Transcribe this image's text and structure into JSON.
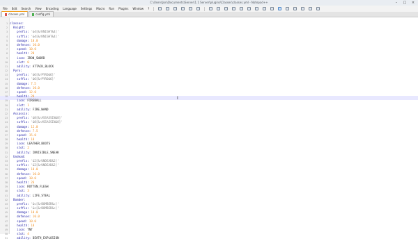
{
  "window": {
    "title": "C:\\Users\\Jon\\Documents\\Server\\1.1 Server\\plugins\\Classes\\classes.yml - Notepad++",
    "controls": [
      "–",
      "□",
      "×"
    ]
  },
  "menu": [
    "File",
    "Edit",
    "Search",
    "View",
    "Encoding",
    "Language",
    "Settings",
    "Macro",
    "Run",
    "Plugins",
    "Window",
    "?"
  ],
  "tabs": [
    {
      "label": "classes.yml",
      "active": true
    },
    {
      "label": "config.yml",
      "active": false
    }
  ],
  "colors": {
    "key": "#1a1aa6",
    "number": "#ef8c1c",
    "string": "#808080",
    "current_line": "#e8e8ff"
  },
  "lines": [
    {
      "n": "1",
      "indent": "",
      "key": "classes:",
      "val": "",
      "type": "t"
    },
    {
      "n": "2",
      "indent": "  ",
      "key": "Knight:",
      "val": "",
      "type": "t"
    },
    {
      "n": "3",
      "indent": "    ",
      "key": "prefix: ",
      "val": "'&4[&rKNIGHT&4]'",
      "type": "s"
    },
    {
      "n": "4",
      "indent": "    ",
      "key": "suffix: ",
      "val": "'&4[&rKNIGHT&4]'",
      "type": "s"
    },
    {
      "n": "5",
      "indent": "    ",
      "key": "damage: ",
      "val": "10.0",
      "type": "v"
    },
    {
      "n": "6",
      "indent": "    ",
      "key": "defense: ",
      "val": "10.0",
      "type": "v"
    },
    {
      "n": "7",
      "indent": "    ",
      "key": "speed: ",
      "val": "10.0",
      "type": "v"
    },
    {
      "n": "8",
      "indent": "    ",
      "key": "health: ",
      "val": "20",
      "type": "v"
    },
    {
      "n": "9",
      "indent": "    ",
      "key": "icon: ",
      "val": "IRON_SWORD",
      "type": "t"
    },
    {
      "n": "10",
      "indent": "    ",
      "key": "slot: ",
      "val": "0",
      "type": "v"
    },
    {
      "n": "11",
      "indent": "    ",
      "key": "ability: ",
      "val": "ATTACK_BLOCK",
      "type": "t"
    },
    {
      "n": "12",
      "indent": "  ",
      "key": "Pyro:",
      "val": "",
      "type": "t"
    },
    {
      "n": "13",
      "indent": "    ",
      "key": "prefix: ",
      "val": "'&6[&rPYRO&6]'",
      "type": "s"
    },
    {
      "n": "14",
      "indent": "    ",
      "key": "suffix: ",
      "val": "'&6[&rPYRO&6]'",
      "type": "s"
    },
    {
      "n": "15",
      "indent": "    ",
      "key": "damage: ",
      "val": "7.5",
      "type": "v"
    },
    {
      "n": "16",
      "indent": "    ",
      "key": "defense: ",
      "val": "10.0",
      "type": "v"
    },
    {
      "n": "17",
      "indent": "    ",
      "key": "speed: ",
      "val": "12.0",
      "type": "v"
    },
    {
      "n": "18",
      "indent": "    ",
      "key": "health: ",
      "val": "20",
      "type": "v"
    },
    {
      "n": "19",
      "indent": "    ",
      "key": "icon: ",
      "val": "FIREBALL",
      "type": "t"
    },
    {
      "n": "20",
      "indent": "    ",
      "key": "slot: ",
      "val": "1",
      "type": "v"
    },
    {
      "n": "21",
      "indent": "    ",
      "key": "ability: ",
      "val": "FIRE_WAND",
      "type": "t"
    },
    {
      "n": "22",
      "indent": "  ",
      "key": "Assassin:",
      "val": "",
      "type": "t"
    },
    {
      "n": "23",
      "indent": "    ",
      "key": "prefix: ",
      "val": "'&8[&rASSASSIN&8]'",
      "type": "s"
    },
    {
      "n": "24",
      "indent": "    ",
      "key": "suffix: ",
      "val": "'&8[&rASSASSIN&8]'",
      "type": "s"
    },
    {
      "n": "25",
      "indent": "    ",
      "key": "damage: ",
      "val": "12.0",
      "type": "v"
    },
    {
      "n": "26",
      "indent": "    ",
      "key": "defense: ",
      "val": "7.5",
      "type": "v"
    },
    {
      "n": "27",
      "indent": "    ",
      "key": "speed: ",
      "val": "15.0",
      "type": "v"
    },
    {
      "n": "28",
      "indent": "    ",
      "key": "health: ",
      "val": "18",
      "type": "v"
    },
    {
      "n": "29",
      "indent": "    ",
      "key": "icon: ",
      "val": "LEATHER_BOOTS",
      "type": "t"
    },
    {
      "n": "30",
      "indent": "    ",
      "key": "slot: ",
      "val": "2",
      "type": "v"
    },
    {
      "n": "31",
      "indent": "    ",
      "key": "ability: ",
      "val": "INVISIBLE_SNEAK",
      "type": "t"
    },
    {
      "n": "32",
      "indent": "  ",
      "key": "Undead:",
      "val": "",
      "type": "t"
    },
    {
      "n": "33",
      "indent": "    ",
      "key": "prefix: ",
      "val": "'&2[&rUNDEAD&2]'",
      "type": "s"
    },
    {
      "n": "34",
      "indent": "    ",
      "key": "suffix: ",
      "val": "'&2[&rUNDEAD&2]'",
      "type": "s"
    },
    {
      "n": "35",
      "indent": "    ",
      "key": "damage: ",
      "val": "10.0",
      "type": "v"
    },
    {
      "n": "36",
      "indent": "    ",
      "key": "defense: ",
      "val": "10.0",
      "type": "v"
    },
    {
      "n": "37",
      "indent": "    ",
      "key": "speed: ",
      "val": "10.0",
      "type": "v"
    },
    {
      "n": "38",
      "indent": "    ",
      "key": "health: ",
      "val": "26",
      "type": "v"
    },
    {
      "n": "39",
      "indent": "    ",
      "key": "icon: ",
      "val": "ROTTEN_FLESH",
      "type": "t"
    },
    {
      "n": "40",
      "indent": "    ",
      "key": "slot: ",
      "val": "3",
      "type": "v"
    },
    {
      "n": "41",
      "indent": "    ",
      "key": "ability: ",
      "val": "LIFE_STEAL",
      "type": "t"
    },
    {
      "n": "42",
      "indent": "  ",
      "key": "Bomber:",
      "val": "",
      "type": "t"
    },
    {
      "n": "43",
      "indent": "    ",
      "key": "prefix: ",
      "val": "'&c[&rBOMBER&c]'",
      "type": "s"
    },
    {
      "n": "44",
      "indent": "    ",
      "key": "suffix: ",
      "val": "'&c[&rBOMBER&c]'",
      "type": "s"
    },
    {
      "n": "45",
      "indent": "    ",
      "key": "damage: ",
      "val": "10.0",
      "type": "v"
    },
    {
      "n": "46",
      "indent": "    ",
      "key": "defense: ",
      "val": "10.0",
      "type": "v"
    },
    {
      "n": "47",
      "indent": "    ",
      "key": "speed: ",
      "val": "10.0",
      "type": "v"
    },
    {
      "n": "48",
      "indent": "    ",
      "key": "health: ",
      "val": "18",
      "type": "v"
    },
    {
      "n": "49",
      "indent": "    ",
      "key": "icon: ",
      "val": "TNT",
      "type": "t"
    },
    {
      "n": "50",
      "indent": "    ",
      "key": "slot: ",
      "val": "4",
      "type": "v"
    },
    {
      "n": "51",
      "indent": "    ",
      "key": "ability: ",
      "val": "DEATH_EXPLOSION",
      "type": "t"
    }
  ]
}
